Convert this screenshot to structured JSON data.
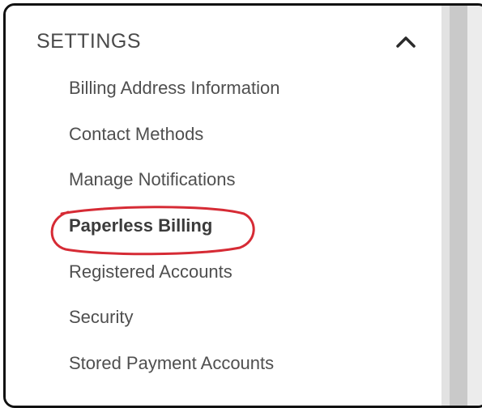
{
  "settings": {
    "title": "SETTINGS",
    "items": [
      {
        "label": "Billing Address Information"
      },
      {
        "label": "Contact Methods"
      },
      {
        "label": "Manage Notifications"
      },
      {
        "label": "Paperless Billing",
        "active": true
      },
      {
        "label": "Registered Accounts"
      },
      {
        "label": "Security"
      },
      {
        "label": "Stored Payment Accounts"
      }
    ]
  },
  "icons": {
    "collapse": "chevron-up-icon"
  },
  "colors": {
    "text": "#4f4f4f",
    "highlight": "#d62b35",
    "border": "#111111"
  }
}
